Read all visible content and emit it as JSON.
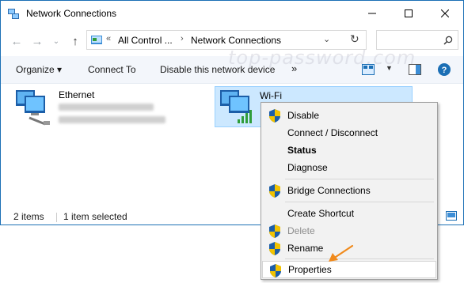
{
  "window": {
    "title": "Network Connections"
  },
  "address": {
    "overflow": "«",
    "segments": [
      "All Control ...",
      "Network Connections"
    ]
  },
  "toolbar": {
    "organize": "Organize ▾",
    "connect_to": "Connect To",
    "disable": "Disable this network device",
    "more": "»"
  },
  "watermark": "top-password.com",
  "items": [
    {
      "name": "Ethernet"
    },
    {
      "name": "Wi-Fi"
    }
  ],
  "status": {
    "count": "2 items",
    "selected": "1 item selected"
  },
  "menu": {
    "disable": "Disable",
    "connect": "Connect / Disconnect",
    "status": "Status",
    "diagnose": "Diagnose",
    "bridge": "Bridge Connections",
    "shortcut": "Create Shortcut",
    "delete": "Delete",
    "rename": "Rename",
    "properties": "Properties"
  },
  "colors": {
    "accent_arrow": "#f08a1c",
    "selection": "#cce8ff",
    "link_blue": "#1b6fb5"
  }
}
